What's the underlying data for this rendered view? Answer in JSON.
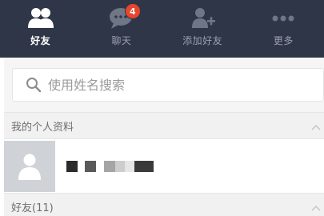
{
  "tabs": [
    {
      "label": "好友",
      "icon": "friends-icon",
      "active": true
    },
    {
      "label": "聊天",
      "icon": "chat-icon",
      "active": false,
      "badge": "4"
    },
    {
      "label": "添加好友",
      "icon": "add-friend-icon",
      "active": false
    },
    {
      "label": "更多",
      "icon": "more-icon",
      "active": false
    }
  ],
  "search": {
    "placeholder": "使用姓名搜索",
    "icon": "search-icon"
  },
  "sections": {
    "profile_header": "我的个人资料",
    "friends_header": "好友(11)"
  },
  "colors": {
    "topbar": "#2f3647",
    "badge": "#e8452c",
    "section_bg": "#f1f1f1",
    "avatar_bg": "#cfd3d7"
  }
}
